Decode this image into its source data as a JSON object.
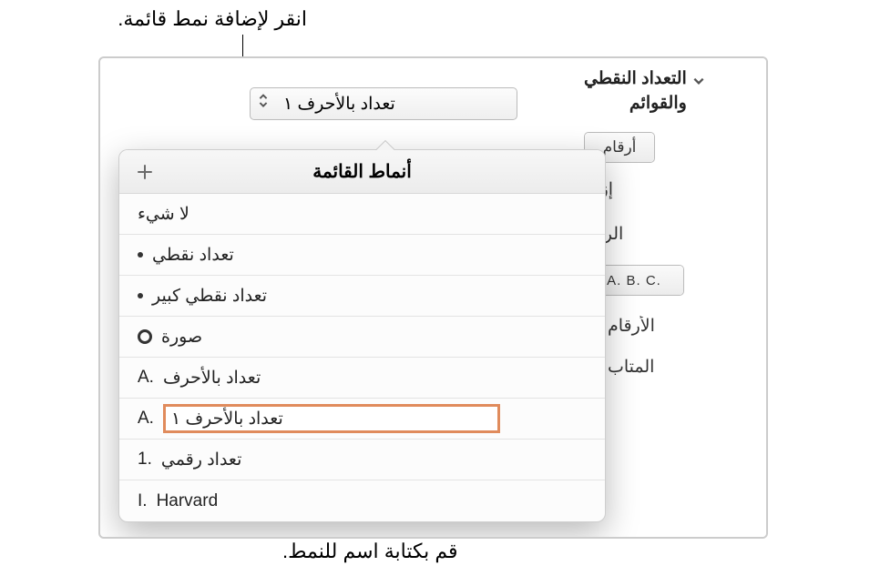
{
  "callouts": {
    "top": "انقر لإضافة نمط قائمة.",
    "bottom": "قم بكتابة اسم للنمط."
  },
  "inspector": {
    "section_title_line1": "التعداد النقطي",
    "section_title_line2": "والقوائم",
    "dropdown_value": "تعداد بالأحرف ١",
    "seg_numbers": "أرقام",
    "label_indent": "إزاح",
    "label_number": "الرقم",
    "format_example": "A. B. C.",
    "label_tiered": "الأرقام",
    "label_continue": "المتاب"
  },
  "popover": {
    "title": "أنماط القائمة",
    "items": {
      "none": "لا شيء",
      "bullet": "تعداد نقطي",
      "bullet_big": "تعداد نقطي كبير",
      "image": "صورة",
      "lettered": "تعداد بالأحرف",
      "lettered_marker": "A.",
      "lettered1": "تعداد بالأحرف ١",
      "lettered1_marker": "A.",
      "numbered": "تعداد رقمي",
      "numbered_marker": "1.",
      "harvard": "Harvard",
      "harvard_marker": "I."
    }
  }
}
